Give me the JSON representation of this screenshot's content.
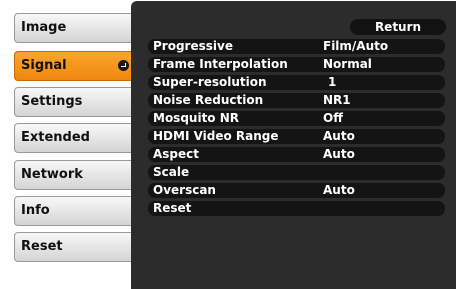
{
  "sidebar": {
    "items": [
      {
        "label": "Image"
      },
      {
        "label": "Signal",
        "active": true
      },
      {
        "label": "Settings"
      },
      {
        "label": "Extended"
      },
      {
        "label": "Network"
      },
      {
        "label": "Info"
      },
      {
        "label": "Reset"
      }
    ]
  },
  "panel": {
    "return_label": "Return",
    "rows": [
      {
        "label": "Progressive",
        "value": "Film/Auto"
      },
      {
        "label": "Frame Interpolation",
        "value": "Normal"
      },
      {
        "label": "Super-resolution",
        "value": "1"
      },
      {
        "label": "Noise Reduction",
        "value": "NR1"
      },
      {
        "label": "Mosquito NR",
        "value": "Off"
      },
      {
        "label": "HDMI Video Range",
        "value": "Auto"
      },
      {
        "label": "Aspect",
        "value": "Auto"
      },
      {
        "label": "Scale",
        "value": ""
      },
      {
        "label": "Overscan",
        "value": "Auto"
      },
      {
        "label": "Reset",
        "value": ""
      }
    ]
  },
  "colors": {
    "active_tab": "#f6951c",
    "panel_bg": "#2c2c2c",
    "row_bg": "#141414"
  },
  "icons": {
    "active_tab_icon": "enter-icon"
  }
}
